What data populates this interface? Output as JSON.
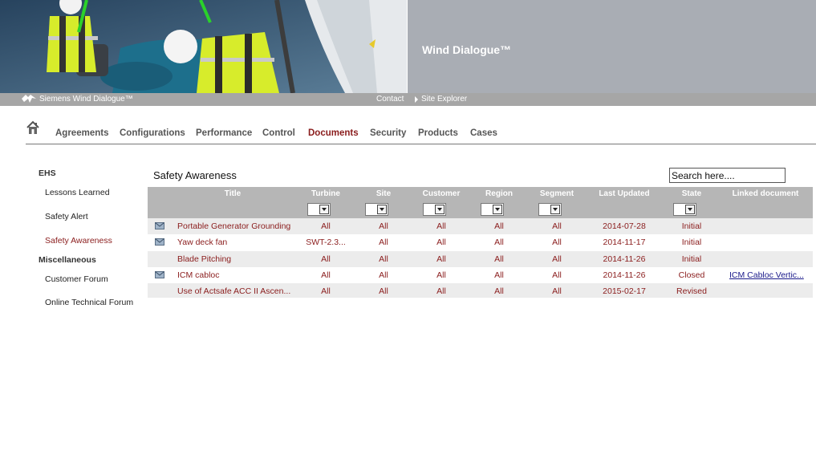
{
  "banner": {
    "title": "Wind Dialogue™"
  },
  "subbar": {
    "brand": "Siemens Wind Dialogue™",
    "contact": "Contact",
    "site_explorer": "Site Explorer"
  },
  "nav": {
    "items": [
      "Agreements",
      "Configurations",
      "Performance",
      "Control",
      "Documents",
      "Security",
      "Products",
      "Cases"
    ],
    "active": "Documents"
  },
  "sidebar": {
    "ehs_heading": "EHS",
    "ehs_items": [
      "Lessons Learned",
      "Safety Alert",
      "Safety Awareness"
    ],
    "misc_heading": "Miscellaneous",
    "misc_items": [
      "Customer Forum",
      "Online Technical Forum"
    ],
    "active": "Safety Awareness"
  },
  "content": {
    "title": "Safety Awareness",
    "search_value": "Search here...."
  },
  "table": {
    "columns": [
      "Title",
      "Turbine",
      "Site",
      "Customer",
      "Region",
      "Segment",
      "Last Updated",
      "State",
      "Linked document"
    ],
    "rows": [
      {
        "icon": "mail-icon",
        "title": "Portable Generator Grounding",
        "turbine": "All",
        "site": "All",
        "customer": "All",
        "region": "All",
        "segment": "All",
        "updated": "2014-07-28",
        "state": "Initial",
        "linked": ""
      },
      {
        "icon": "mail-icon",
        "title": "Yaw deck fan",
        "turbine": "SWT-2.3...",
        "site": "All",
        "customer": "All",
        "region": "All",
        "segment": "All",
        "updated": "2014-11-17",
        "state": "Initial",
        "linked": ""
      },
      {
        "icon": "",
        "title": "Blade Pitching",
        "turbine": "All",
        "site": "All",
        "customer": "All",
        "region": "All",
        "segment": "All",
        "updated": "2014-11-26",
        "state": "Initial",
        "linked": ""
      },
      {
        "icon": "mail-icon",
        "title": "ICM cabloc",
        "turbine": "All",
        "site": "All",
        "customer": "All",
        "region": "All",
        "segment": "All",
        "updated": "2014-11-26",
        "state": "Closed",
        "linked": "ICM Cabloc Vertic..."
      },
      {
        "icon": "",
        "title": "Use of Actsafe ACC II Ascen...",
        "turbine": "All",
        "site": "All",
        "customer": "All",
        "region": "All",
        "segment": "All",
        "updated": "2015-02-17",
        "state": "Revised",
        "linked": ""
      }
    ]
  },
  "colors": {
    "accent": "#8a1c1c",
    "header_gray": "#b6b6b6",
    "banner_gray": "#a9adb4",
    "link": "#1a1a8a"
  }
}
